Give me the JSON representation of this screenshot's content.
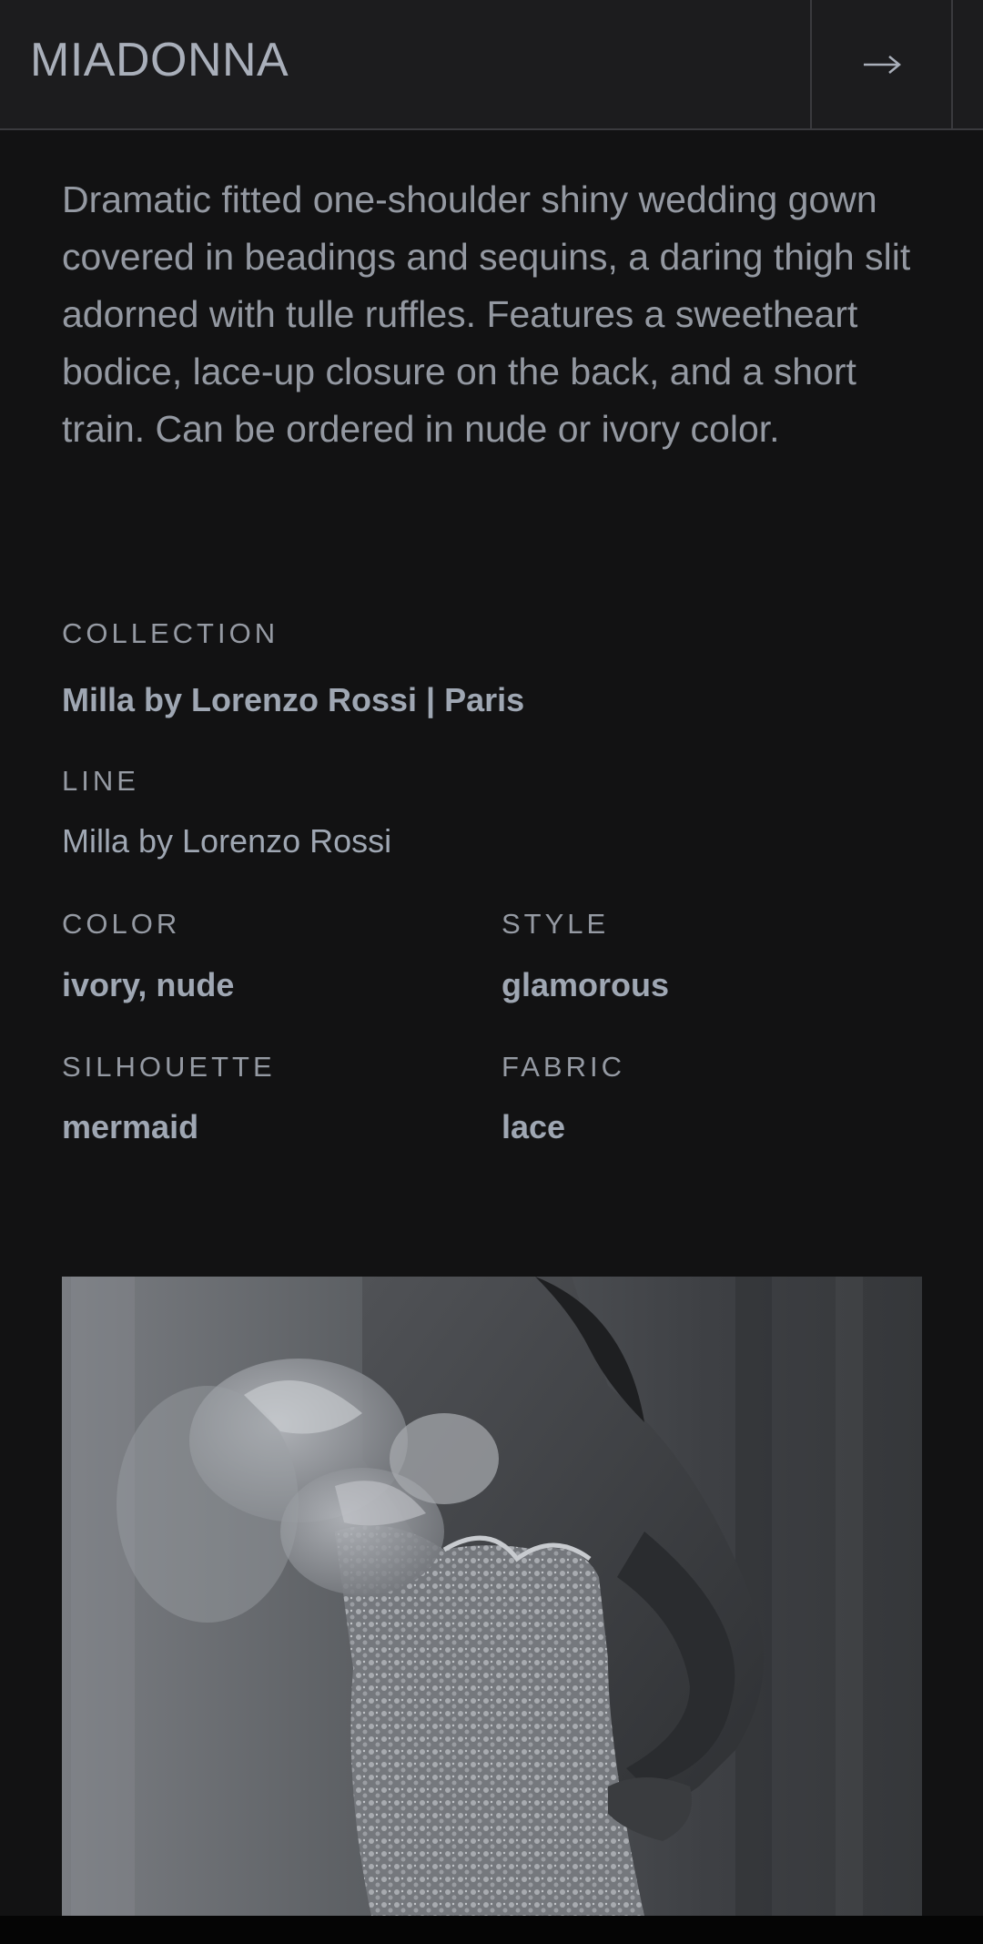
{
  "header": {
    "logo": "MIADONNA",
    "next_icon": "arrow-right-icon"
  },
  "product": {
    "description": "Dramatic fitted one-shoulder shiny wedding gown covered in beadings and sequins, a daring thigh slit adorned with tulle ruffles. Features a sweetheart bodice, lace-up closure on the back, and a short train. Can be ordered in nude or ivory color."
  },
  "details": {
    "collection_label": "COLLECTION",
    "collection_value": "Milla by Lorenzo Rossi | Paris",
    "line_label": "LINE",
    "line_value": "Milla by Lorenzo Rossi",
    "color_label": "COLOR",
    "color_value": "ivory, nude",
    "style_label": "STYLE",
    "style_value": "glamorous",
    "silhouette_label": "SILHOUETTE",
    "silhouette_value": "mermaid",
    "fabric_label": "FABRIC",
    "fabric_value": "lace"
  },
  "colors": {
    "background": "#121213",
    "header_background": "#1c1c1e",
    "text": "#9ea3ad"
  }
}
